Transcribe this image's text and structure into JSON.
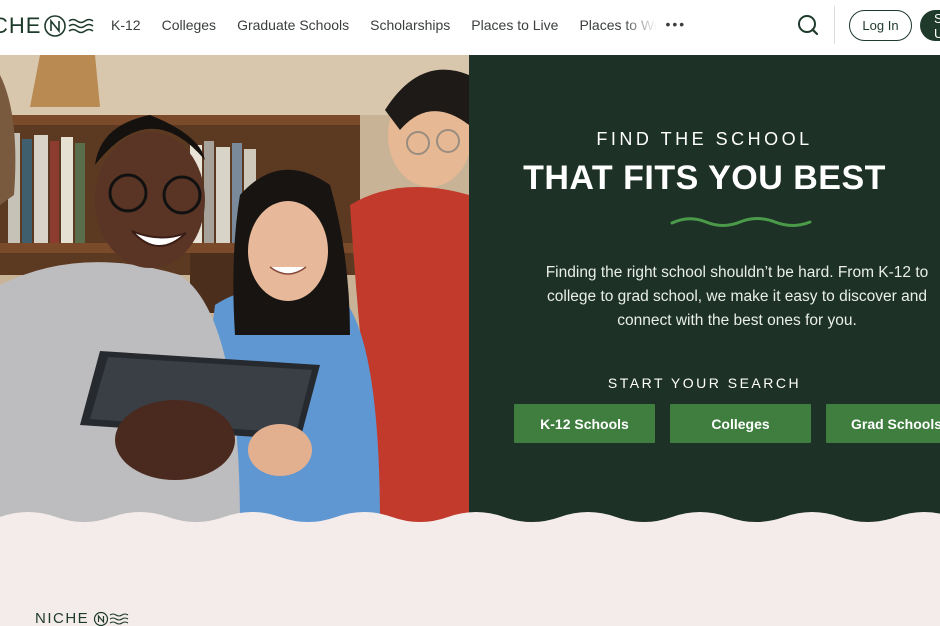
{
  "header": {
    "logo_text": "NICHE",
    "nav": [
      {
        "label": "K-12"
      },
      {
        "label": "Colleges"
      },
      {
        "label": "Graduate Schools"
      },
      {
        "label": "Scholarships"
      },
      {
        "label": "Places to Live"
      },
      {
        "label": "Places to Work"
      }
    ],
    "more_label": "•••",
    "login_label": "Log In",
    "signup_label": "Sign Up"
  },
  "hero": {
    "eyebrow": "FIND THE SCHOOL",
    "headline": "THAT FITS YOU BEST",
    "description": "Finding the right school shouldn’t be hard. From K-12 to college to grad school, we make it easy to discover and connect with the best ones for you.",
    "start_label": "START YOUR SEARCH",
    "buttons": [
      {
        "label": "K-12 Schools"
      },
      {
        "label": "Colleges"
      },
      {
        "label": "Grad Schools"
      }
    ]
  },
  "footer": {
    "logo_text": "NICHE"
  },
  "colors": {
    "brand_dark": "#1d3126",
    "cta_green": "#3f7e3f",
    "accent_green": "#4a9a4a",
    "page_bg": "#f4ecea"
  },
  "icons": [
    "niche-logo-icon",
    "search-icon",
    "more-dots-icon",
    "squiggle-divider"
  ]
}
